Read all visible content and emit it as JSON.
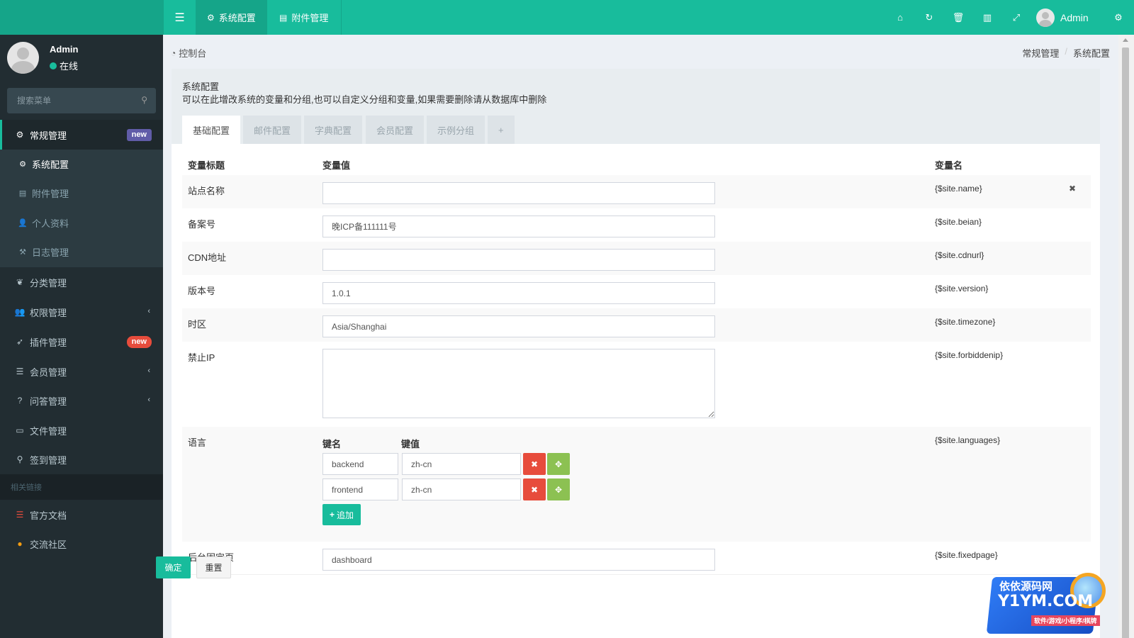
{
  "header": {
    "menu_toggle_icon": "bars-icon",
    "tabs": [
      {
        "label": "系统配置",
        "icon": "gear-icon",
        "active": true
      },
      {
        "label": "附件管理",
        "icon": "file-image-icon",
        "active": false
      }
    ],
    "right_icons": [
      "home-icon",
      "refresh-icon",
      "trash-icon",
      "translate-icon",
      "expand-icon"
    ],
    "user_name": "Admin",
    "settings_icon": "gears-icon"
  },
  "sidebar": {
    "user": {
      "name": "Admin",
      "status": "在线"
    },
    "search_placeholder": "搜索菜单",
    "items": [
      {
        "label": "常规管理",
        "icon": "gears-icon",
        "badge": "new"
      },
      {
        "label": "系统配置",
        "icon": "gear-icon"
      },
      {
        "label": "附件管理",
        "icon": "file-image-icon"
      },
      {
        "label": "个人资料",
        "icon": "user-icon"
      },
      {
        "label": "日志管理",
        "icon": "log-icon"
      },
      {
        "label": "分类管理",
        "icon": "leaf-icon"
      },
      {
        "label": "权限管理",
        "icon": "group-icon"
      },
      {
        "label": "插件管理",
        "icon": "rocket-icon",
        "badge": "new"
      },
      {
        "label": "会员管理",
        "icon": "list-icon"
      },
      {
        "label": "问答管理",
        "icon": "question-icon"
      },
      {
        "label": "文件管理",
        "icon": "folder-icon"
      },
      {
        "label": "签到管理",
        "icon": "map-marker-icon"
      }
    ],
    "section_header": "相关链接",
    "links": [
      {
        "label": "官方文档",
        "icon": "list-red-icon",
        "color": "#e74c3c"
      },
      {
        "label": "交流社区",
        "icon": "comment-icon",
        "color": "#f39c12"
      }
    ]
  },
  "breadcrumb": {
    "left_label": "控制台",
    "right": [
      "常规管理",
      "系统配置"
    ]
  },
  "panel": {
    "title": "系统配置",
    "description": "可以在此增改系统的变量和分组,也可以自定义分组和变量,如果需要删除请从数据库中删除",
    "tabs": [
      "基础配置",
      "邮件配置",
      "字典配置",
      "会员配置",
      "示例分组",
      "+"
    ]
  },
  "table": {
    "headers": {
      "title": "变量标题",
      "value": "变量值",
      "name": "变量名"
    },
    "rows": [
      {
        "title": "站点名称",
        "value": "",
        "var": "{$site.name}"
      },
      {
        "title": "备案号",
        "value": "晚ICP备111111号",
        "var": "{$site.beian}"
      },
      {
        "title": "CDN地址",
        "value": "",
        "var": "{$site.cdnurl}"
      },
      {
        "title": "版本号",
        "value": "1.0.1",
        "var": "{$site.version}"
      },
      {
        "title": "时区",
        "value": "Asia/Shanghai",
        "var": "{$site.timezone}"
      },
      {
        "title": "禁止IP",
        "value": "",
        "var": "{$site.forbiddenip}"
      },
      {
        "title": "语言",
        "var": "{$site.languages}"
      },
      {
        "title": "后台固定页",
        "value": "dashboard",
        "var": "{$site.fixedpage}"
      }
    ],
    "languages": {
      "key_header": "键名",
      "value_header": "键值",
      "pairs": [
        {
          "key": "backend",
          "value": "zh-cn"
        },
        {
          "key": "frontend",
          "value": "zh-cn"
        }
      ],
      "append_label": "追加"
    }
  },
  "actions": {
    "confirm": "确定",
    "reset": "重置"
  },
  "watermark": {
    "line1": "依依源码网",
    "line2": "Y1YM.COM",
    "line3": "软件/游戏/小程序/棋牌"
  },
  "colors": {
    "primary": "#18bc9c",
    "sidebar_bg": "#222d32",
    "danger": "#e74c3c",
    "success_alt": "#8cc152",
    "badge_purple": "#605ca8"
  }
}
